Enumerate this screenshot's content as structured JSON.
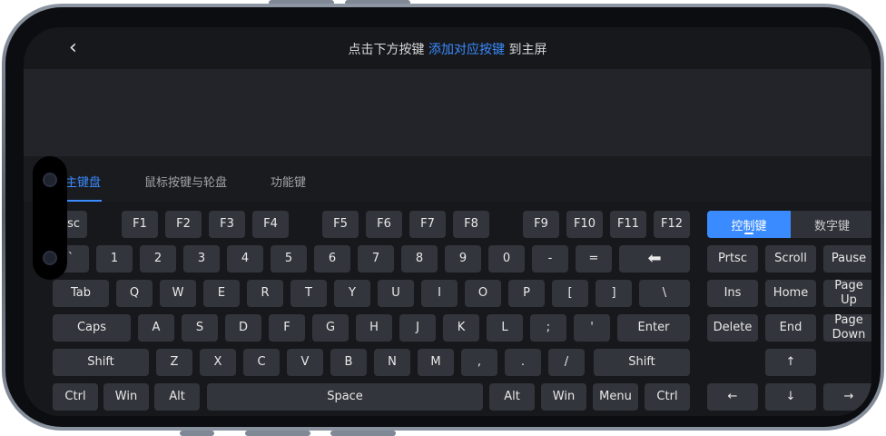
{
  "header": {
    "back_icon": "‹",
    "title_part1": "点击下方按键 ",
    "title_highlight": "添加对应按键",
    "title_part2": " 到主屏"
  },
  "tabs": [
    {
      "label": "主键盘",
      "active": true
    },
    {
      "label": "鼠标按键与轮盘",
      "active": false
    },
    {
      "label": "功能键",
      "active": false
    }
  ],
  "segment": {
    "control_label": "控制键",
    "numeric_label": "数字键"
  },
  "colors": {
    "accent": "#3a8bff",
    "key_bg": "#32353b",
    "screen_bg": "#17181c"
  },
  "keys": {
    "esc": "Esc",
    "f1": "F1",
    "f2": "F2",
    "f3": "F3",
    "f4": "F4",
    "f5": "F5",
    "f6": "F6",
    "f7": "F7",
    "f8": "F8",
    "f9": "F9",
    "f10": "F10",
    "f11": "F11",
    "f12": "F12",
    "backtick": "`",
    "n1": "1",
    "n2": "2",
    "n3": "3",
    "n4": "4",
    "n5": "5",
    "n6": "6",
    "n7": "7",
    "n8": "8",
    "n9": "9",
    "n0": "0",
    "minus": "-",
    "equals": "=",
    "backspace": "⬅",
    "tab": "Tab",
    "q": "Q",
    "w": "W",
    "e": "E",
    "r": "R",
    "t": "T",
    "y": "Y",
    "u": "U",
    "i": "I",
    "o": "O",
    "p": "P",
    "lbracket": "[",
    "rbracket": "]",
    "backslash": "\\",
    "caps": "Caps",
    "a": "A",
    "s": "S",
    "d": "D",
    "f": "F",
    "g": "G",
    "h": "H",
    "j": "J",
    "k": "K",
    "l": "L",
    "semicolon": ";",
    "quote": "'",
    "enter": "Enter",
    "lshift": "Shift",
    "z": "Z",
    "x": "X",
    "c": "C",
    "v": "V",
    "b": "B",
    "n": "N",
    "m": "M",
    "comma": ",",
    "period": ".",
    "slash": "/",
    "rshift": "Shift",
    "lctrl": "Ctrl",
    "lwin": "Win",
    "lalt": "Alt",
    "space": "Space",
    "ralt": "Alt",
    "rwin": "Win",
    "menu": "Menu",
    "rctrl": "Ctrl",
    "prtsc": "Prtsc",
    "scroll": "Scroll",
    "pause": "Pause",
    "ins": "Ins",
    "home": "Home",
    "pageup": "Page\nUp",
    "delete": "Delete",
    "end": "End",
    "pagedown": "Page\nDown",
    "up": "↑",
    "left": "←",
    "down": "↓",
    "right": "→"
  }
}
